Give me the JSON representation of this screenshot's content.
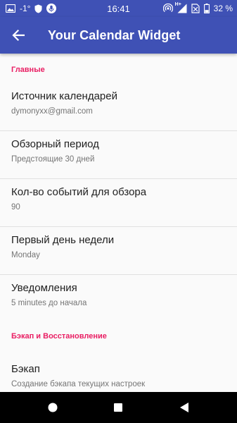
{
  "status_bar": {
    "signal_text": "-1°",
    "time": "16:41",
    "network_label": "H+",
    "battery": "32 %"
  },
  "app_bar": {
    "title": "Your Calendar Widget",
    "back_icon": "arrow-back-icon"
  },
  "sections": [
    {
      "header": "Главные",
      "items": [
        {
          "title": "Источник календарей",
          "summary": "dymonyxx@gmail.com"
        },
        {
          "title": "Обзорный период",
          "summary": "Предстоящие 30 дней"
        },
        {
          "title": "Кол-во событий для обзора",
          "summary": "90"
        },
        {
          "title": "Первый день недели",
          "summary": "Monday"
        },
        {
          "title": "Уведомления",
          "summary": "5 minutes до начала"
        }
      ]
    },
    {
      "header": "Бэкап и Восстановление",
      "items": [
        {
          "title": "Бэкап",
          "summary": "Создание бэкапа текущих настроек"
        }
      ]
    }
  ],
  "nav_bar": {
    "home_icon": "home-circle-icon",
    "recents_icon": "recents-square-icon",
    "back_icon": "back-triangle-icon"
  },
  "colors": {
    "primary": "#3f51b5",
    "accent": "#e91e63",
    "background": "#fafafa"
  }
}
